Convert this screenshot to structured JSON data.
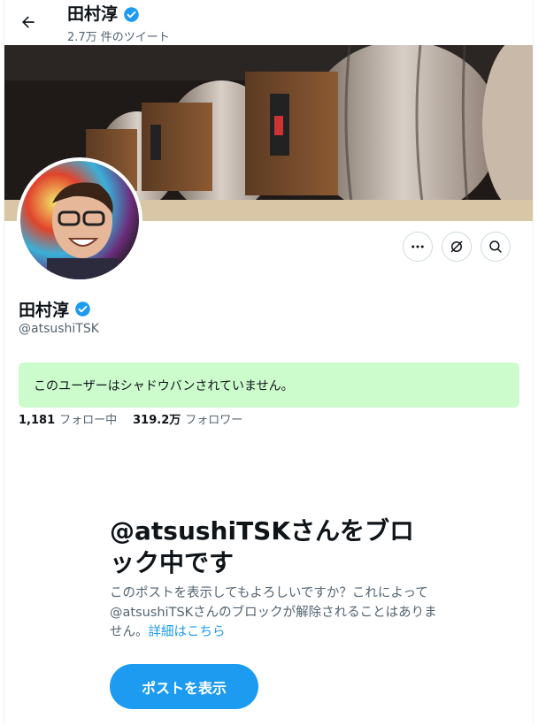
{
  "header": {
    "back_icon": "arrow-left-icon",
    "name": "田村淳",
    "tweet_count": "2.7万 件のツイート"
  },
  "profile": {
    "name": "田村淳",
    "handle": "@atsushiTSK",
    "verified_icon": "verified-badge-icon"
  },
  "actions": {
    "more_icon": "more-icon",
    "extension_icon": "slashed-circle-icon",
    "search_icon": "search-icon"
  },
  "shadowban_notice": "このユーザーはシャドウバンされていません。",
  "stats": {
    "following_count": "1,181",
    "following_label": "フォロー中",
    "followers_count": "319.2万",
    "followers_label": "フォロワー"
  },
  "block": {
    "title": "@atsushiTSKさんをブロック中です",
    "description": "このポストを表示してもよろしいですか？これによって@atsushiTSKさんのブロックが解除されることはありません。",
    "learn_more": "詳細はこちら",
    "show_button": "ポストを表示"
  },
  "colors": {
    "accent": "#1d9bf0",
    "notice_bg": "#ccfccc",
    "text_secondary": "#536471"
  }
}
